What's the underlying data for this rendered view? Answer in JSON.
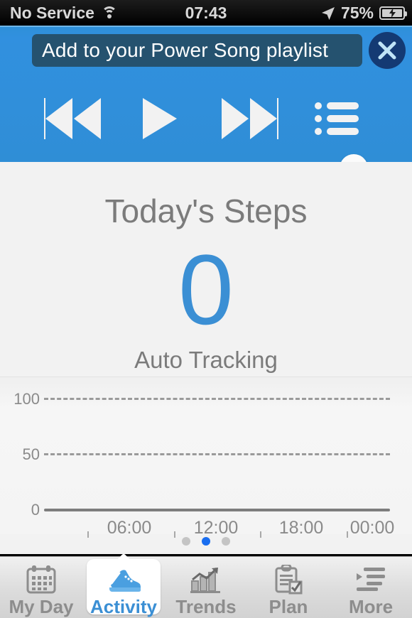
{
  "status_bar": {
    "carrier": "No Service",
    "time": "07:43",
    "battery_percent": "75%",
    "wifi_icon": "wifi-icon",
    "location_icon": "location-arrow-icon",
    "battery_icon": "battery-charging-icon"
  },
  "player": {
    "banner_text": "Add to your Power Song playlist",
    "close_icon": "close-x-icon",
    "prev_icon": "rewind-icon",
    "play_icon": "play-icon",
    "next_icon": "fast-forward-icon",
    "list_icon": "playlist-icon",
    "progress_percent": 93,
    "accent_color": "#3190df",
    "track_color": "#8fe9fb"
  },
  "main": {
    "title": "Today's Steps",
    "value": "0",
    "subtitle": "Auto Tracking",
    "value_color": "#3b8fd4",
    "text_color": "#7b7b7b"
  },
  "chart_data": {
    "type": "line",
    "title": "Today's Steps",
    "xlabel": "",
    "ylabel": "",
    "x_tick_labels": [
      "06:00",
      "12:00",
      "18:00",
      "00:00"
    ],
    "x_tick_positions": [
      0.25,
      0.5,
      0.75,
      1.0
    ],
    "y_tick_labels": [
      "100",
      "50",
      "0"
    ],
    "y_values": [
      100,
      50,
      0
    ],
    "ylim": [
      0,
      100
    ],
    "grid": true,
    "grid_style": "dashed",
    "series": [
      {
        "name": "Steps",
        "values": []
      }
    ],
    "legend": "none"
  },
  "pagination": {
    "total": 3,
    "active_index": 1,
    "active_color": "#1a6ef0",
    "inactive_color": "#c4c4c4"
  },
  "tabbar": {
    "active_index": 1,
    "active_color": "#3b8fd4",
    "items": [
      {
        "label": "My Day",
        "icon": "calendar-icon"
      },
      {
        "label": "Activity",
        "icon": "running-shoe-icon"
      },
      {
        "label": "Trends",
        "icon": "bar-chart-trend-icon"
      },
      {
        "label": "Plan",
        "icon": "clipboard-check-icon"
      },
      {
        "label": "More",
        "icon": "list-indent-icon"
      }
    ]
  }
}
